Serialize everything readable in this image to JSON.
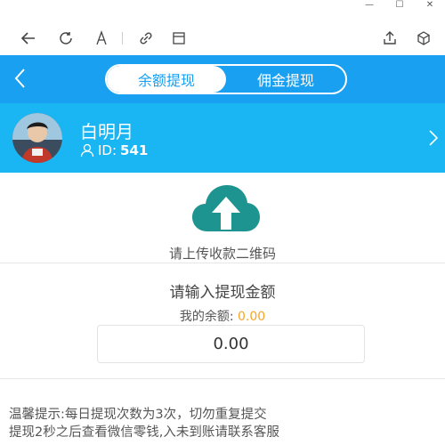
{
  "window": {
    "controls": [
      "—",
      "☐",
      "✕"
    ]
  },
  "toolbar": {
    "icons": [
      "back-arrow-icon",
      "refresh-icon",
      "text-size-icon",
      "link-icon",
      "layout-icon",
      "share-icon",
      "cube-icon"
    ]
  },
  "header": {
    "tabs": [
      {
        "label": "余额提现",
        "active": true
      },
      {
        "label": "佣金提现",
        "active": false
      }
    ]
  },
  "user": {
    "name": "白明月",
    "id_label": "ID:",
    "id_value": "541"
  },
  "upload": {
    "label": "请上传收款二维码"
  },
  "amount": {
    "title": "请输入提现金额",
    "balance_label": "我的余额:",
    "balance_value": "0.00",
    "input_value": "0.00"
  },
  "tips": {
    "line1": "温馨提示:每日提现次数为3次，切勿重复提交",
    "line2": "提现2秒之后查看微信零钱,入未到账请联系客服"
  },
  "colors": {
    "header_bg": "#1aa0f0",
    "banner_bg": "#1ab6f4",
    "cloud": "#1e9490",
    "balance_value": "#f5a623"
  }
}
